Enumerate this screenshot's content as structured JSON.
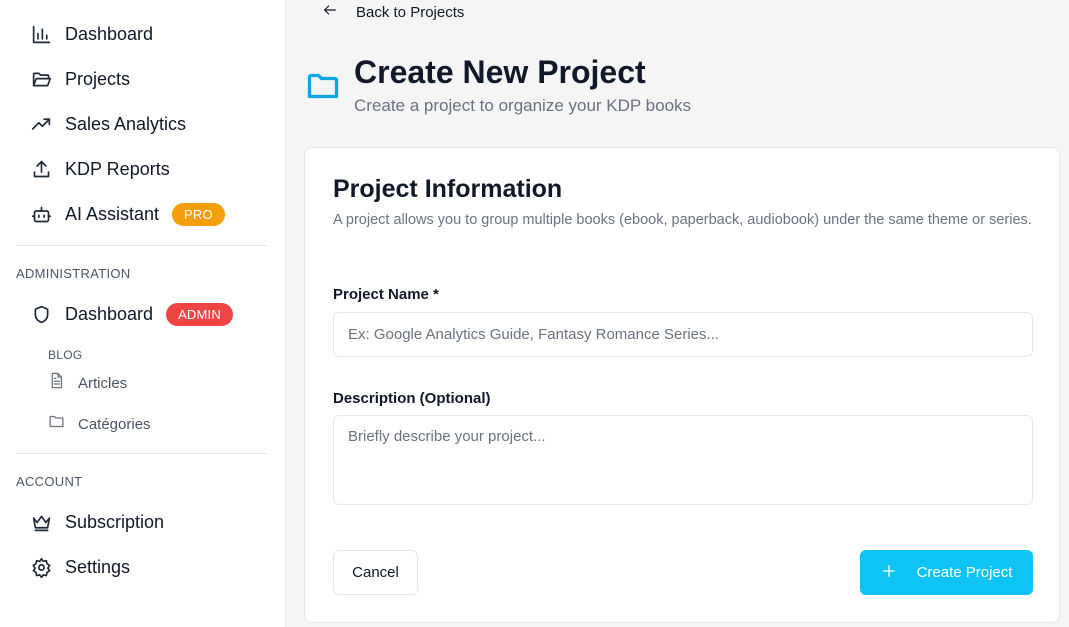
{
  "sidebar": {
    "main_items": [
      {
        "label": "Dashboard",
        "icon": "bar-chart-icon"
      },
      {
        "label": "Projects",
        "icon": "folder-open-icon"
      },
      {
        "label": "Sales Analytics",
        "icon": "trending-up-icon"
      },
      {
        "label": "KDP Reports",
        "icon": "upload-icon"
      },
      {
        "label": "AI Assistant",
        "icon": "bot-icon",
        "badge": "PRO"
      }
    ],
    "administration": {
      "title": "ADMINISTRATION",
      "dashboard": {
        "label": "Dashboard",
        "icon": "shield-icon",
        "badge": "ADMIN"
      },
      "blog": {
        "title": "BLOG",
        "items": [
          {
            "label": "Articles",
            "icon": "file-text-icon"
          },
          {
            "label": "Catégories",
            "icon": "folder-icon"
          }
        ]
      }
    },
    "account": {
      "title": "ACCOUNT",
      "items": [
        {
          "label": "Subscription",
          "icon": "crown-icon"
        },
        {
          "label": "Settings",
          "icon": "gear-icon"
        }
      ]
    }
  },
  "main": {
    "back_label": "Back to Projects",
    "title": "Create New Project",
    "subtitle": "Create a project to organize your KDP books",
    "card": {
      "title": "Project Information",
      "description": "A project allows you to group multiple books (ebook, paperback, audiobook) under the same theme or series.",
      "name_label": "Project Name *",
      "name_placeholder": "Ex: Google Analytics Guide, Fantasy Romance Series...",
      "name_value": "",
      "description_label": "Description (Optional)",
      "description_placeholder": "Briefly describe your project...",
      "description_value": "",
      "cancel_label": "Cancel",
      "create_label": "Create Project"
    }
  },
  "colors": {
    "accent": "#0ec4f5",
    "pro_badge": "#f59e0b",
    "admin_badge": "#ef4444"
  }
}
